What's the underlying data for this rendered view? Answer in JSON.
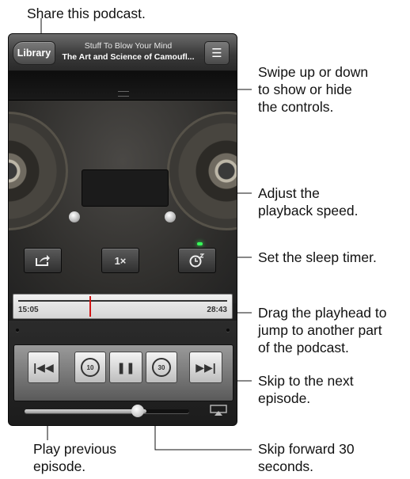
{
  "navbar": {
    "library_label": "Library",
    "podcast_title": "Stuff To Blow Your Mind",
    "episode_title": "The Art and Science of Camoufl..."
  },
  "controls": {
    "speed_label": "1×"
  },
  "scrubber": {
    "elapsed": "15:05",
    "remaining": "28:43",
    "progress": 0.34
  },
  "volume": {
    "level": 0.74
  },
  "icons": {
    "share": "share-icon",
    "sleep": "sleep-timer-icon",
    "list": "list-icon",
    "previous": "previous-episode-icon",
    "back15": "skip-back-15-icon",
    "pause": "pause-icon",
    "forward30": "skip-forward-30-icon",
    "next": "next-episode-icon",
    "airplay": "airplay-icon"
  },
  "skip_back_seconds": "10",
  "skip_forward_seconds": "30",
  "callouts": {
    "share": "Share this podcast.",
    "swipe": "Swipe up or down\nto show or hide\nthe controls.",
    "speed": "Adjust the\nplayback speed.",
    "sleep": "Set the sleep timer.",
    "playhead": "Drag the playhead to\njump to another part\nof the podcast.",
    "next": "Skip to the next\nepisode.",
    "previous": "Play previous\nepisode.",
    "forward": "Skip forward 30\nseconds."
  },
  "colors": {
    "playhead": "#d21414",
    "sleep_led": "#36ff59"
  }
}
